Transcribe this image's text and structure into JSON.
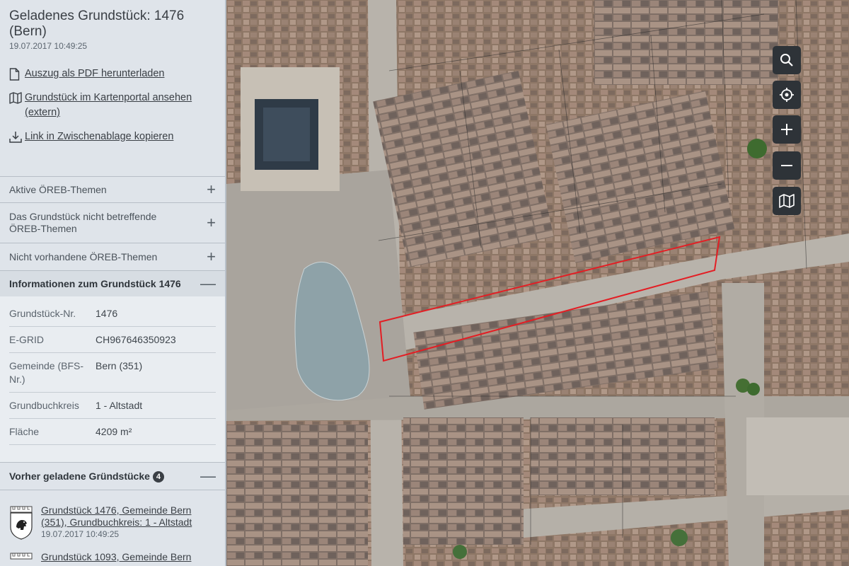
{
  "header": {
    "title": "Geladenes Grundstück: 1476 (Bern)",
    "timestamp": "19.07.2017 10:49:25"
  },
  "actions": {
    "pdf": "Auszug als PDF herunterladen",
    "portal": "Grundstück im Kartenportal ansehen (extern)",
    "link": "Link in Zwischenablage kopieren"
  },
  "sections": {
    "active": "Aktive ÖREB-Themen",
    "not_concerning": "Das Grundstück nicht betreffende ÖREB-Themen",
    "not_available": "Nicht vorhandene ÖREB-Themen",
    "info": "Informationen zum Grundstück 1476"
  },
  "info": [
    {
      "key": "Grundstück-Nr.",
      "value": "1476"
    },
    {
      "key": "E-GRID",
      "value": "CH967646350923"
    },
    {
      "key": "Gemeinde (BFS-Nr.)",
      "value": "Bern (351)"
    },
    {
      "key": "Grundbuchkreis",
      "value": "1 - Altstadt"
    },
    {
      "key": "Fläche",
      "value": "4209 m²"
    }
  ],
  "previous": {
    "title": "Vorher geladene Gründstücke",
    "count": "4",
    "items": [
      {
        "label": "Grundstück 1476, Gemeinde Bern (351), Grundbuchkreis: 1 - Altstadt",
        "timestamp": "19.07.2017 10:49:25"
      },
      {
        "label": "Grundstück 1093, Gemeinde Bern",
        "timestamp": ""
      }
    ]
  },
  "map_controls": [
    "search-icon",
    "locate-icon",
    "zoom-in-icon",
    "zoom-out-icon",
    "layers-map-icon"
  ],
  "colors": {
    "sidebar_bg": "#dfe4ea",
    "control_bg": "#2e3338",
    "highlight": "#e31e24"
  }
}
